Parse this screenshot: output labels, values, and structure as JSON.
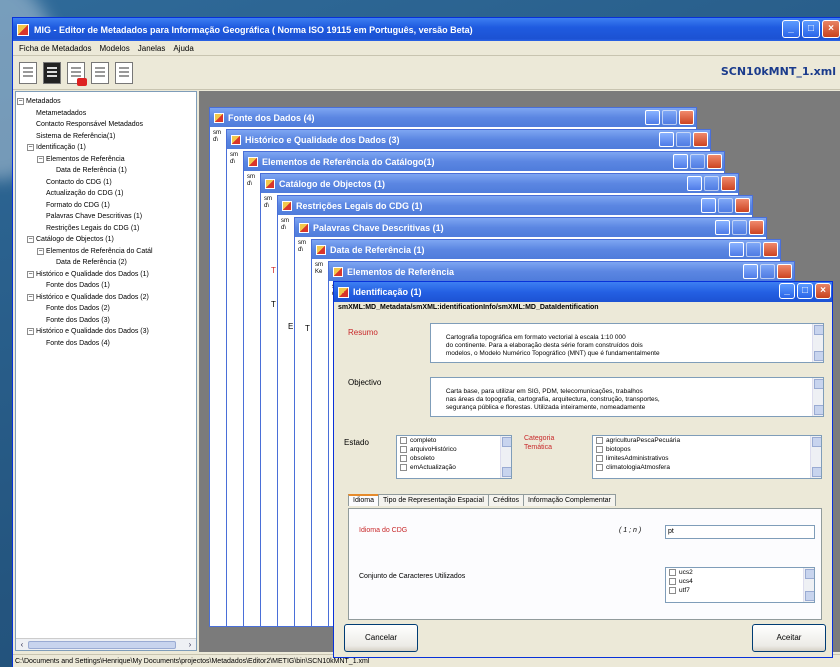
{
  "window": {
    "title": "MIG - Editor de Metadados para Informação Geográfica ( Norma ISO 19115 em Português, versão Beta)",
    "min_glyph": "_",
    "max_glyph": "□",
    "close_glyph": "×"
  },
  "menu": [
    "Ficha de Metadados",
    "Modelos",
    "Janelas",
    "Ajuda"
  ],
  "toolbar": {
    "icons": [
      "new-document-icon",
      "save-icon",
      "xml-export-icon",
      "page-icon",
      "copy-page-icon"
    ],
    "filename": "SCN10kMNT_1.xml"
  },
  "tree": {
    "items": [
      {
        "label": "Metadados",
        "level": 0,
        "expander": "−"
      },
      {
        "label": "Metametadados",
        "level": 1,
        "expander": ""
      },
      {
        "label": "Contacto Responsável Metadados",
        "level": 1,
        "expander": ""
      },
      {
        "label": "Sistema de Referência(1)",
        "level": 1,
        "expander": ""
      },
      {
        "label": "Identificação (1)",
        "level": 1,
        "expander": "−"
      },
      {
        "label": "Elementos de Referência",
        "level": 2,
        "expander": "−"
      },
      {
        "label": "Data de Referência (1)",
        "level": 3,
        "expander": ""
      },
      {
        "label": "Contacto do CDG (1)",
        "level": 2,
        "expander": ""
      },
      {
        "label": "Actualização do CDG (1)",
        "level": 2,
        "expander": ""
      },
      {
        "label": "Formato do CDG (1)",
        "level": 2,
        "expander": ""
      },
      {
        "label": "Palavras Chave Descritivas (1)",
        "level": 2,
        "expander": ""
      },
      {
        "label": "Restrições Legais do CDG (1)",
        "level": 2,
        "expander": ""
      },
      {
        "label": "Catálogo de Objectos (1)",
        "level": 1,
        "expander": "−"
      },
      {
        "label": "Elementos de Referência do Catál",
        "level": 2,
        "expander": "−"
      },
      {
        "label": "Data de Referência (2)",
        "level": 3,
        "expander": ""
      },
      {
        "label": "Histórico e Qualidade dos Dados (1)",
        "level": 1,
        "expander": "−"
      },
      {
        "label": "Fonte dos Dados (1)",
        "level": 2,
        "expander": ""
      },
      {
        "label": "Histórico e Qualidade dos Dados (2)",
        "level": 1,
        "expander": "−"
      },
      {
        "label": "Fonte dos Dados (2)",
        "level": 2,
        "expander": ""
      },
      {
        "label": "Fonte dos Dados (3)",
        "level": 2,
        "expander": ""
      },
      {
        "label": "Histórico e Qualidade dos Dados (3)",
        "level": 1,
        "expander": "−"
      },
      {
        "label": "Fonte dos Dados (4)",
        "level": 2,
        "expander": ""
      }
    ]
  },
  "cascade": [
    {
      "title": "Fonte dos Dados (4)",
      "frag": "sm\nd\\"
    },
    {
      "title": "Histórico e Qualidade dos Dados (3)",
      "frag": "sm\nd\\"
    },
    {
      "title": "Elementos de Referência do Catálogo(1)",
      "frag": "sm\nd\\"
    },
    {
      "title": "Catálogo de Objectos (1)",
      "frag": "sm\nd\\"
    },
    {
      "title": "Restrições Legais do CDG (1)",
      "frag": "sm\nd\\"
    },
    {
      "title": "Palavras Chave Descritivas (1)",
      "frag": "sm\nd\\"
    },
    {
      "title": "Data de Referência (1)",
      "frag": "sm\nKe"
    },
    {
      "title": "Elementos de Referência",
      "frag": "sm\nd\\"
    }
  ],
  "cascade_letters": [
    "T",
    "T",
    "E",
    "T"
  ],
  "front": {
    "title": "Identificação (1)",
    "path": "smXML:MD_Metadata/smXML:identificationInfo/smXML:MD_DataIdentification",
    "resumo_label": "Resumo",
    "resumo_text": "Cartografia topográfica em formato vectorial à escala 1:10 000\n      do continente. Para a elaboração desta série foram construídos dois\n      modelos, o Modelo Numérico Topográfico (MNT) que é fundamentalmente",
    "objectivo_label": "Objectivo",
    "objectivo_text": "Carta base, para utilizar em SIG, PDM, telecomunicações, trabalhos\n      nas áreas da topografia, cartografia, arquitectura, construção, transportes,\n      segurança pública e florestas. Utilizada inteiramente, nomeadamente",
    "estado_label": "Estado",
    "estado_items": [
      "completo",
      "arquivoHistórico",
      "obsoleto",
      "emActualização"
    ],
    "categoria_label": "Categoria\nTemática",
    "categoria_items": [
      "agriculturaPescaPecuária",
      "biotopos",
      "limitesAdministrativos",
      "climatologiaAtmosfera"
    ],
    "tabs": [
      "Idioma",
      "Tipo de Representação Espacial",
      "Créditos",
      "Informação Complementar"
    ],
    "idioma_label": "Idioma do CDG",
    "idioma_range": "( 1 ; n )",
    "idioma_value": "pt",
    "charset_label": "Conjunto de Caracteres Utilizados",
    "charset_items": [
      "ucs2",
      "ucs4",
      "utf7"
    ],
    "cancel": "Cancelar",
    "accept": "Aceitar"
  },
  "status": "C:\\Documents and Settings\\Henrique\\My Documents\\projectos\\Metadados\\Editor2\\METIG\\bin\\SCN10kMNT_1.xml"
}
